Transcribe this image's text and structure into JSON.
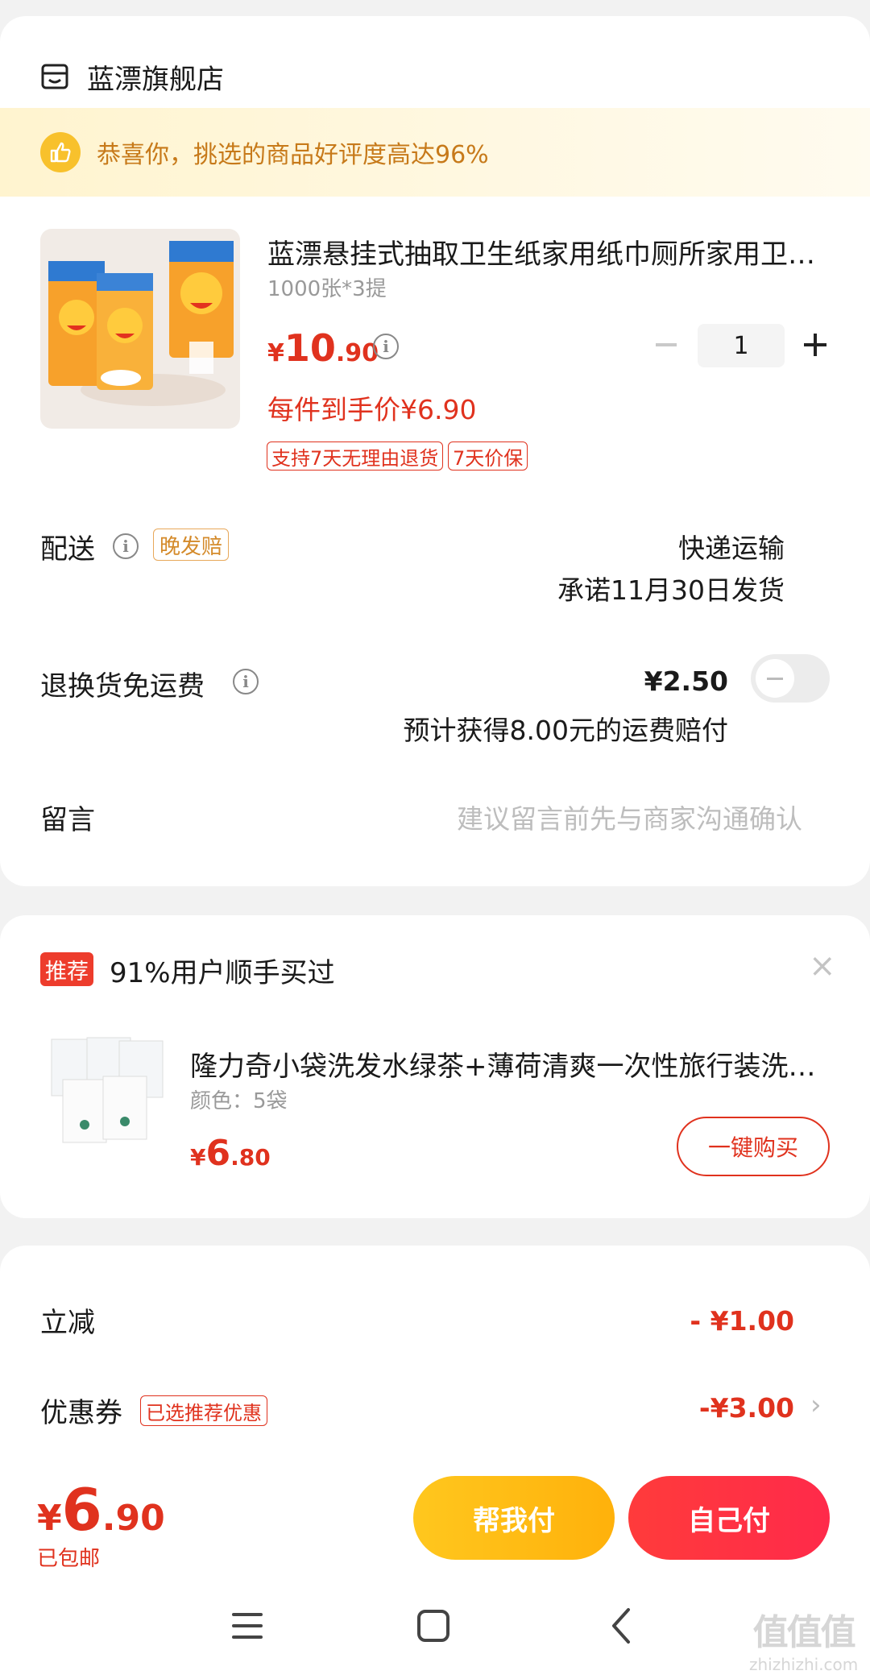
{
  "store": {
    "name": "蓝漂旗舰店"
  },
  "banner": {
    "text": "恭喜你，挑选的商品好评度高达96%"
  },
  "product": {
    "title": "蓝漂悬挂式抽取卫生纸家用纸巾厕所家用卫生纸",
    "spec": "1000张*3提",
    "price_symbol": "¥",
    "price_int": "10",
    "price_dec": ".90",
    "each_price": "每件到手价¥6.90",
    "tags": [
      "支持7天无理由退货",
      "7天价保"
    ],
    "quantity": "1"
  },
  "delivery": {
    "label": "配送",
    "badge": "晚发赔",
    "method": "快递运输",
    "promise": "承诺11月30日发货"
  },
  "return_shipping": {
    "label": "退换货免运费",
    "price": "¥2.50",
    "note": "预计获得8.00元的运费赔付",
    "enabled": false
  },
  "message": {
    "label": "留言",
    "placeholder": "建议留言前先与商家沟通确认"
  },
  "recommend": {
    "badge": "推荐",
    "title": "91%用户顺手买过",
    "close": "×",
    "item_name": "隆力奇小袋洗发水绿茶+薄荷清爽一次性旅行装洗发水",
    "item_spec": "颜色：5袋",
    "price_symbol": "¥",
    "price_int": "6",
    "price_dec": ".80",
    "buy_label": "一键购买"
  },
  "discounts": {
    "instant_label": "立减",
    "instant_value": "- ¥1.00",
    "coupon_label": "优惠券",
    "coupon_tag": "已选推荐优惠",
    "coupon_value": "-¥3.00"
  },
  "checkout": {
    "price_symbol": "¥",
    "price_int": "6",
    "price_dec": ".90",
    "shipping_note": "已包邮",
    "help_pay_label": "帮我付",
    "self_pay_label": "自己付"
  },
  "watermark": {
    "big": "值值值",
    "small": "zhizhizhi.com"
  },
  "colors": {
    "accent": "#e0321e",
    "help_btn": "#ffb80f",
    "self_btn": "#ff3040",
    "banner_text": "#c77a1a"
  }
}
